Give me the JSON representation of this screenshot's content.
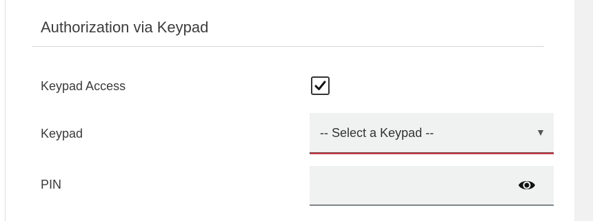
{
  "section": {
    "title": "Authorization via Keypad"
  },
  "fields": {
    "keypad_access": {
      "label": "Keypad Access",
      "checked": true
    },
    "keypad": {
      "label": "Keypad",
      "selected": "-- Select a Keypad --",
      "arrow": "▼",
      "accent_color": "#e22b3a"
    },
    "pin": {
      "label": "PIN",
      "value": "",
      "toggle_icon": "eye-icon"
    }
  }
}
